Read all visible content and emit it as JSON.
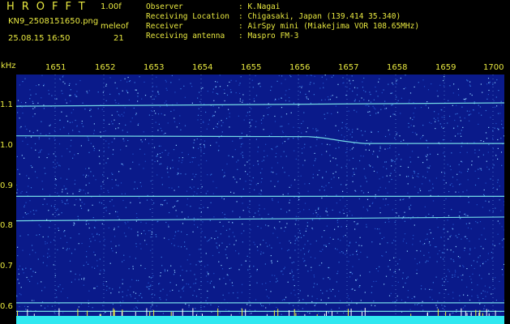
{
  "header": {
    "app_title": "HROFFT",
    "version": "1.00f",
    "filename": "KN9_2508151650.png",
    "mode_label": "meleof",
    "datetime": "25.08.15 16:50",
    "count": "21",
    "info": [
      {
        "key": "Observer",
        "value": ": K.Nagai"
      },
      {
        "key": "Receiving Location",
        "value": ": Chigasaki, Japan (139.414 35.340)"
      },
      {
        "key": "Receiver",
        "value": ": AirSpy mini (Miakejima VOR 108.65MHz)"
      },
      {
        "key": "Receiving antenna",
        "value": ": Maspro FM-3"
      }
    ]
  },
  "chart_data": {
    "type": "heatmap",
    "ylabel": "kHz",
    "x_ticks": [
      "1651",
      "1652",
      "1653",
      "1654",
      "1655",
      "1656",
      "1657",
      "1658",
      "1659",
      "1700"
    ],
    "y_ticks": [
      "1.1",
      "1.0",
      "0.9",
      "0.8",
      "0.7",
      "0.6"
    ],
    "ylim": [
      0.57,
      1.16
    ],
    "traces": [
      {
        "from_khz": 1.085,
        "to_khz": 1.093
      },
      {
        "from_khz": 1.015,
        "to_khz": 0.997
      },
      {
        "from_khz": 0.872,
        "to_khz": 0.872
      },
      {
        "from_khz": 0.814,
        "to_khz": 0.823
      },
      {
        "from_khz": 0.62,
        "to_khz": 0.62
      },
      {
        "from_khz": 0.6,
        "to_khz": 0.6
      }
    ],
    "colors": {
      "background": "#0a1a8a",
      "noise": "#3a7be0",
      "trace": "#7ff0f0",
      "axis_text": "#e8e840"
    }
  }
}
